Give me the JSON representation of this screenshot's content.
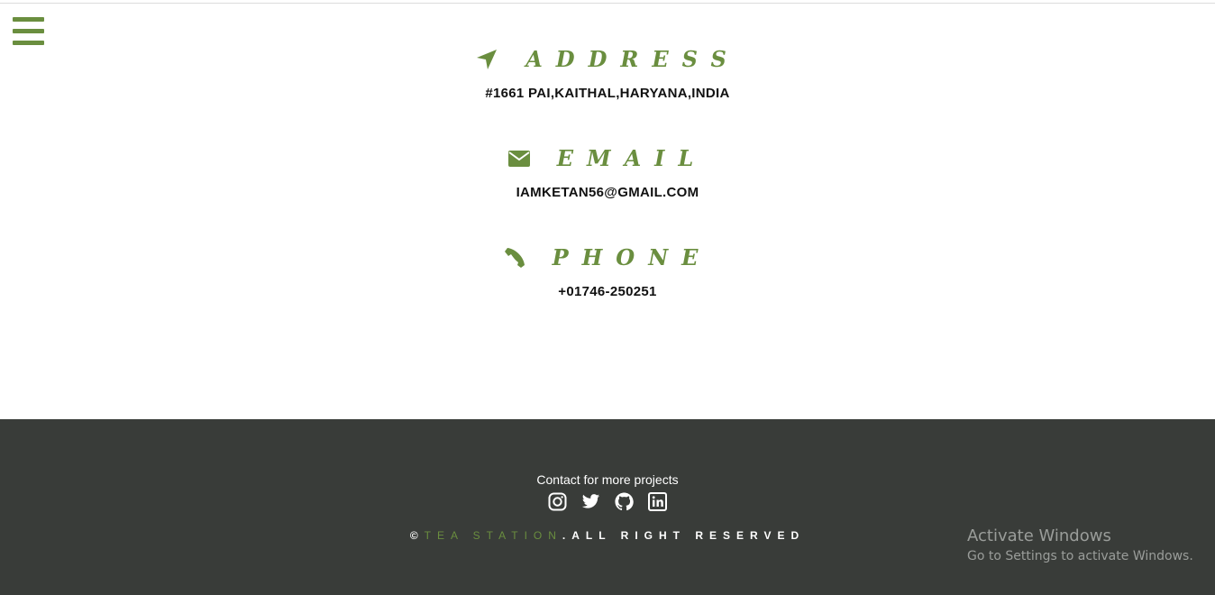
{
  "nav": {
    "menu_icon": "hamburger-icon"
  },
  "contact": {
    "address": {
      "icon": "location-arrow-icon",
      "label": "ADDRESS",
      "value": "#1661 PAI,KAITHAL,HARYANA,INDIA"
    },
    "email": {
      "icon": "envelope-icon",
      "label": "EMAIL",
      "value": "IAMKETAN56@GMAIL.COM"
    },
    "phone": {
      "icon": "phone-icon",
      "label": "PHONE",
      "value": "+01746-250251"
    }
  },
  "footer": {
    "title": "Contact for more projects",
    "social": [
      "instagram-icon",
      "twitter-icon",
      "github-icon",
      "linkedin-icon"
    ],
    "copyright_symbol": "©",
    "brand": "TEA STATION",
    "rights": ".ALL RIGHT RESERVED"
  },
  "watermark": {
    "title": "Activate Windows",
    "subtitle": "Go to Settings to activate Windows."
  },
  "colors": {
    "accent": "#6a8e3f",
    "footer_bg": "#393c39",
    "text": "#111111"
  }
}
